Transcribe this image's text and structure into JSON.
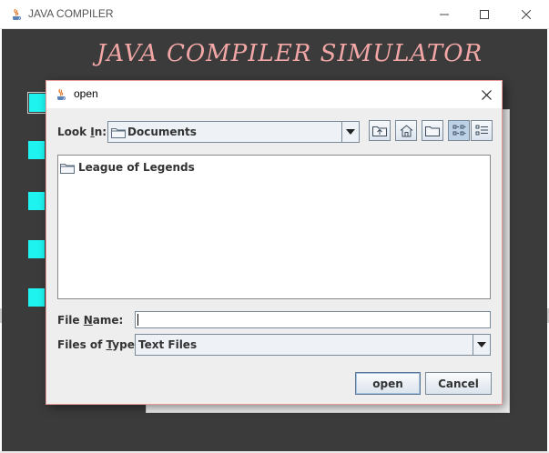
{
  "main_window": {
    "title": "JAVA COMPILER",
    "banner": "JAVA COMPILER SIMULATOR",
    "icon": "java-coffee-icon",
    "controls": [
      "minimize-icon",
      "maximize-icon",
      "close-icon"
    ]
  },
  "colors": {
    "main_background": "#3b3b3b",
    "banner_text": "#f2a6a6",
    "cyan_button": "#1ff3f0",
    "dialog_border": "#e89a9a",
    "dialog_background": "#eeeeee"
  },
  "dialog": {
    "title": "open",
    "icon": "java-coffee-icon",
    "look_in": {
      "label_prefix": "Look ",
      "label_mnemonic": "I",
      "label_suffix": "n:",
      "value": "Documents"
    },
    "toolbar": {
      "buttons": [
        "up-one-level-icon",
        "home-icon",
        "new-folder-icon",
        "list-view-icon",
        "details-view-icon"
      ]
    },
    "files": [
      {
        "name": "League of Legends",
        "icon": "folder-icon"
      }
    ],
    "file_name": {
      "label_prefix": "File ",
      "label_mnemonic": "N",
      "label_suffix": "ame:",
      "value": ""
    },
    "files_of_type": {
      "label_prefix": "Files of ",
      "label_mnemonic": "T",
      "label_suffix": "ype:",
      "value": "Text Files"
    },
    "buttons": {
      "open": "open",
      "cancel": "Cancel"
    }
  }
}
